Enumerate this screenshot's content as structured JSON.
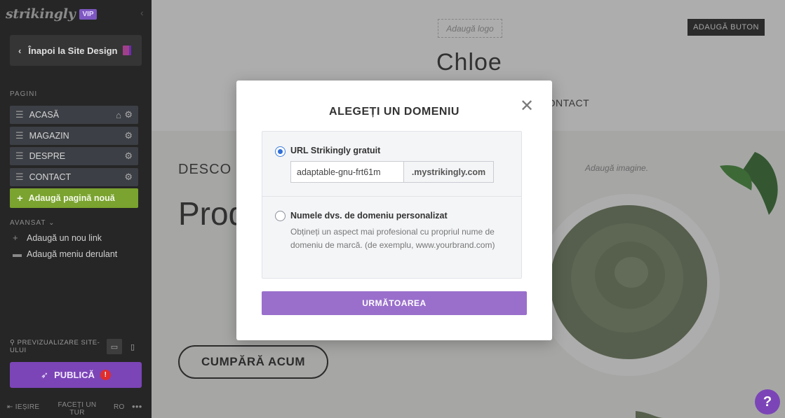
{
  "sidebar": {
    "logo": "strikingly",
    "vip": "VIP",
    "back_label": "Înapoi la Site Design",
    "pages_label": "PAGINI",
    "pages": [
      {
        "label": "ACASĂ",
        "home": true
      },
      {
        "label": "MAGAZIN",
        "home": false
      },
      {
        "label": "DESPRE",
        "home": false
      },
      {
        "label": "CONTACT",
        "home": false
      }
    ],
    "add_page_label": "Adaugă pagină nouă",
    "advanced_label": "AVANSAT",
    "add_link_label": "Adaugă un nou link",
    "add_dropdown_label": "Adaugă meniu derulant",
    "preview_label": "PREVIZUALIZARE SITE-ULUI",
    "publish_label": "PUBLICĂ",
    "publish_warning": "!",
    "footer": {
      "exit_label": "IEȘIRE",
      "tour_label": "FACEȚI UN TUR",
      "lang_label": "RO"
    }
  },
  "site": {
    "logo_placeholder": "Adaugă logo",
    "button_label": "ADAUGĂ BUTON",
    "title": "Chloe",
    "nav_contact": "CONTACT",
    "hero_subtitle": "DESCO",
    "hero_title": "Prod baza min",
    "image_placeholder": "Adaugă imagine.",
    "cta_label": "CUMPĂRĂ ACUM"
  },
  "modal": {
    "title": "ALEGEȚI UN DOMENIU",
    "close_icon": "close-icon",
    "option_free_label": "URL Strikingly gratuit",
    "option_free_selected": true,
    "url_value": "adaptable-gnu-frt61m",
    "url_suffix": ".mystrikingly.com",
    "option_custom_label": "Numele dvs. de domeniu personalizat",
    "option_custom_selected": false,
    "option_custom_desc": "Obțineți un aspect mai profesional cu propriul nume de domeniu de marcă. (de exemplu, www.yourbrand.com)",
    "next_label": "URMĂTOAREA"
  },
  "help_label": "?",
  "colors": {
    "accent": "#7b45b7",
    "add_page_green": "#7aa32f",
    "next_button": "#9a6fcc",
    "radio_blue": "#2f6fd8"
  }
}
